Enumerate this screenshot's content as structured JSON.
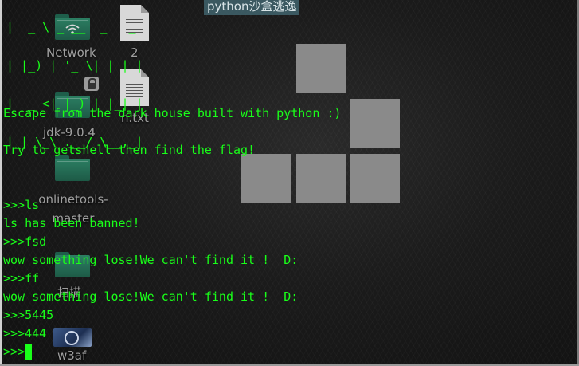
{
  "window": {
    "title": "python沙盒逃逸"
  },
  "desktop": {
    "icons": [
      {
        "label": "Network"
      },
      {
        "label": "2"
      },
      {
        "label": "jdk-9.0.4"
      },
      {
        "label": "n.txt"
      },
      {
        "label": "onlinetools-master"
      },
      {
        "label": "扫描"
      },
      {
        "label": "w3af"
      }
    ]
  },
  "terminal": {
    "banner_lines": [
      "|  _ \\ _ __  _   _ ",
      "| |_) | '_ \\| | | |",
      "|  _ <| |_) | |_| |",
      "|_| \\_\\ .__/ \\__,_|"
    ],
    "lines": [
      "Escape from the dark house built with python :)",
      "Try to getshell then find the flag!",
      ">>>ls",
      "ls has been banned!",
      ">>>fsd",
      "wow something lose!We can't find it !  D:",
      ">>>ff",
      "wow something lose!We can't find it !  D:",
      ">>>5445",
      ">>>444",
      ">>>"
    ],
    "text_color": "#19ff19"
  }
}
